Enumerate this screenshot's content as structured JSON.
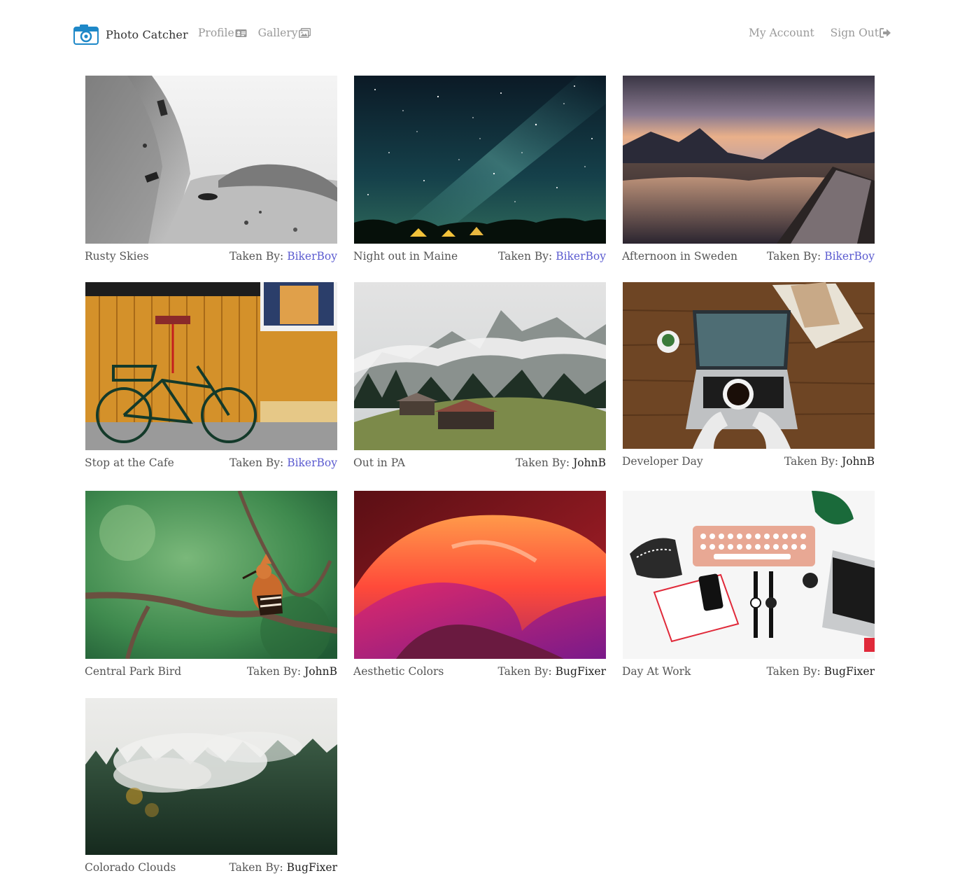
{
  "nav": {
    "brand": "Photo Catcher",
    "left_links": [
      {
        "label": "Profile",
        "icon": "id-card-icon"
      },
      {
        "label": "Gallery",
        "icon": "images-icon"
      }
    ],
    "right_links": [
      {
        "label": "My Account"
      },
      {
        "label": "Sign Out",
        "icon": "sign-out-icon"
      }
    ]
  },
  "taken_by_label": "Taken By:",
  "colors": {
    "link": "#5b5bd0",
    "nav_text": "#9a9a9a",
    "brand_blue": "#1e88c8"
  },
  "photos": [
    {
      "title": "Rusty Skies",
      "author": "BikerBoy",
      "author_is_link": true,
      "image": "black-and-white-airplane-wreck"
    },
    {
      "title": "Night out in Maine",
      "author": "BikerBoy",
      "author_is_link": true,
      "image": "starry-night-sky-over-houses"
    },
    {
      "title": "Afternoon in Sweden",
      "author": "BikerBoy",
      "author_is_link": true,
      "image": "lake-between-mountains-at-sunset-from-boat"
    },
    {
      "title": "Stop at the Cafe",
      "author": "BikerBoy",
      "author_is_link": true,
      "image": "green-bicycle-against-wooden-wall"
    },
    {
      "title": "Out in PA",
      "author": "JohnB",
      "author_is_link": false,
      "image": "cabins-in-misty-alpine-valley"
    },
    {
      "title": "Developer Day",
      "author": "JohnB",
      "author_is_link": false,
      "image": "laptop-and-coffee-on-wooden-desk"
    },
    {
      "title": "Central Park Bird",
      "author": "JohnB",
      "author_is_link": false,
      "image": "hoopoe-bird-on-branch"
    },
    {
      "title": "Aesthetic Colors",
      "author": "BugFixer",
      "author_is_link": false,
      "image": "colorful-slot-canyon"
    },
    {
      "title": "Day At Work",
      "author": "BugFixer",
      "author_is_link": false,
      "image": "flat-lay-keyboard-watches-laptop"
    },
    {
      "title": "Colorado Clouds",
      "author": "BugFixer",
      "author_is_link": false,
      "image": "misty-pine-forest"
    }
  ]
}
